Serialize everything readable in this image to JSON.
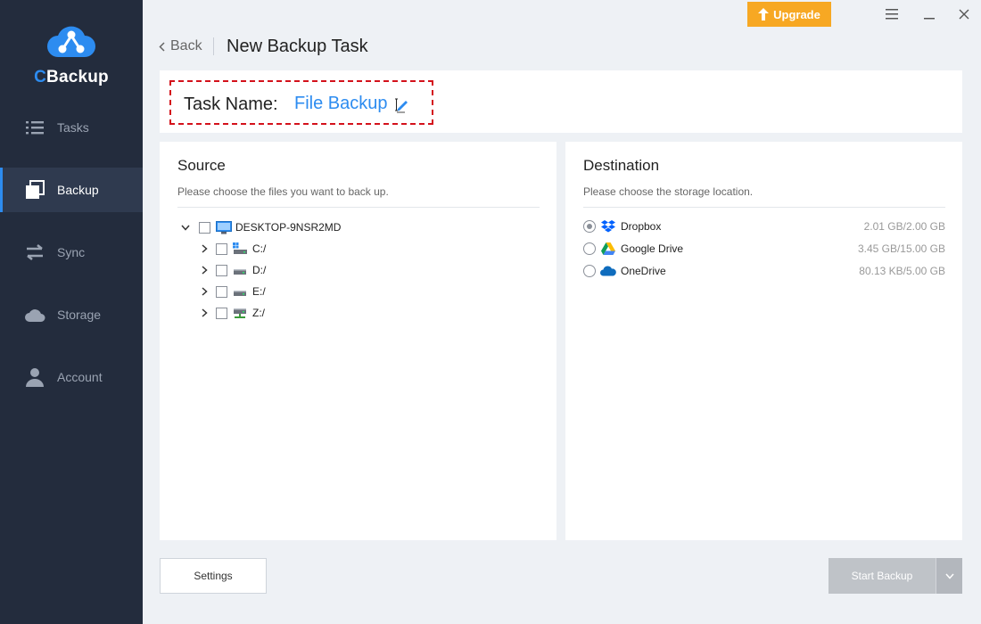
{
  "app": {
    "name_first": "C",
    "name_rest": "Backup"
  },
  "sidebar": {
    "items": [
      {
        "label": "Tasks",
        "icon": "list-icon"
      },
      {
        "label": "Backup",
        "icon": "copy-icon",
        "active": true
      },
      {
        "label": "Sync",
        "icon": "sync-arrows-icon"
      },
      {
        "label": "Storage",
        "icon": "cloud-icon"
      },
      {
        "label": "Account",
        "icon": "user-icon"
      }
    ]
  },
  "topbar": {
    "upgrade_label": "Upgrade"
  },
  "header": {
    "back_label": "Back",
    "title": "New Backup Task"
  },
  "task": {
    "label": "Task Name:",
    "value": "File Backup"
  },
  "source": {
    "title": "Source",
    "subtitle": "Please choose the files you want to back up.",
    "root": "DESKTOP-9NSR2MD",
    "drives": [
      "C:/",
      "D:/",
      "E:/",
      "Z:/"
    ]
  },
  "destination": {
    "title": "Destination",
    "subtitle": "Please choose the storage location.",
    "items": [
      {
        "name": "Dropbox",
        "size": "2.01 GB/2.00 GB",
        "selected": true
      },
      {
        "name": "Google Drive",
        "size": "3.45 GB/15.00 GB",
        "selected": false
      },
      {
        "name": "OneDrive",
        "size": "80.13 KB/5.00 GB",
        "selected": false
      }
    ]
  },
  "footer": {
    "settings_label": "Settings",
    "start_label": "Start Backup"
  },
  "colors": {
    "accent": "#2d8cf0",
    "sidebar_bg": "#232c3d",
    "upgrade": "#f7a823",
    "highlight_border": "#d4111b"
  }
}
